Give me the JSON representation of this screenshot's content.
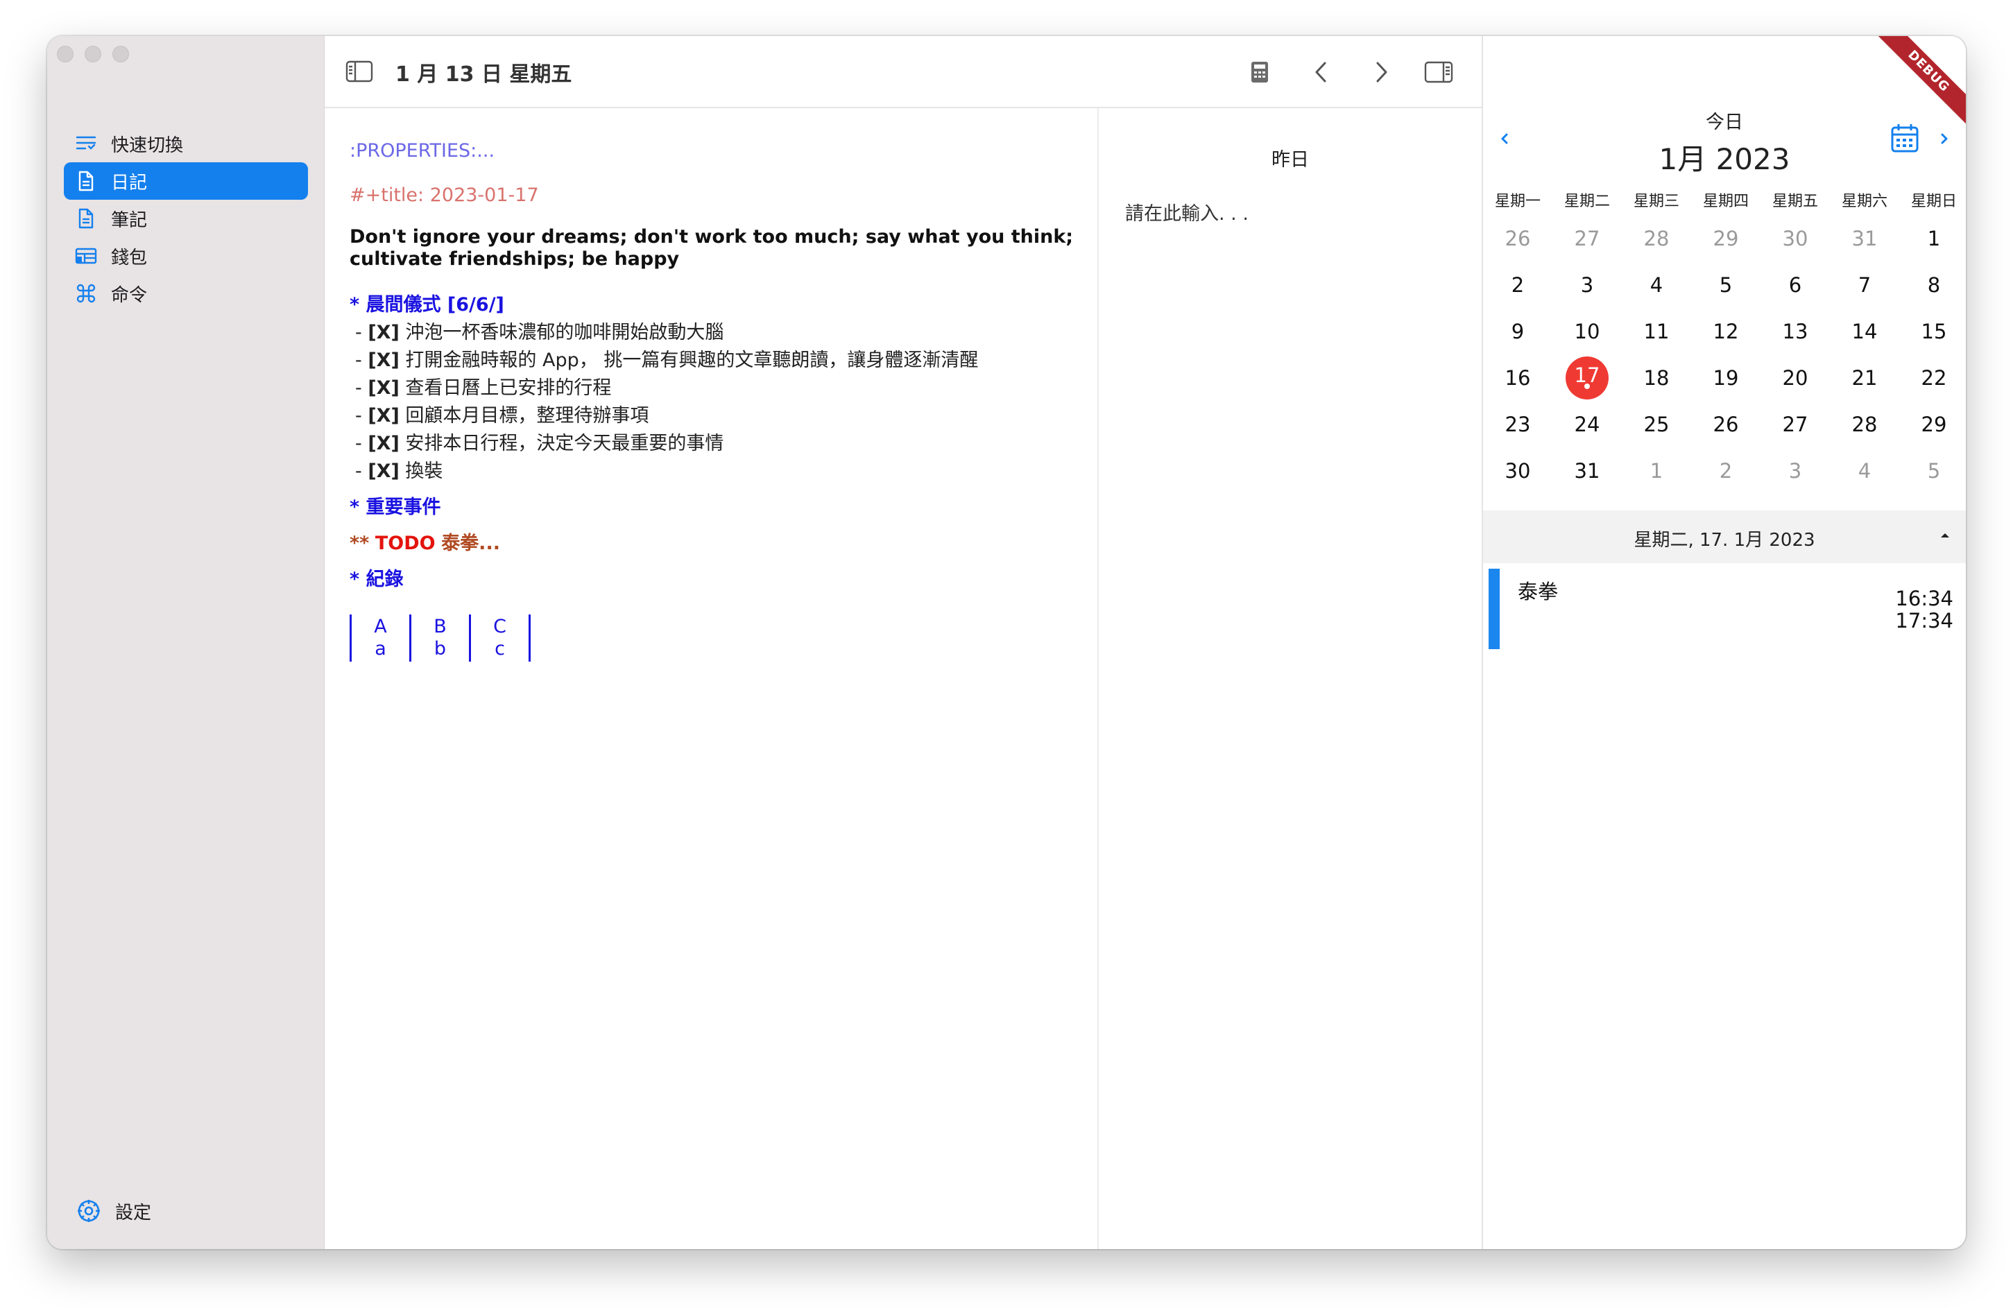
{
  "sidebar": {
    "items": [
      {
        "label": "快速切換",
        "icon": "quick-switch-icon"
      },
      {
        "label": "日記",
        "icon": "document-icon",
        "active": true
      },
      {
        "label": "筆記",
        "icon": "document-icon"
      },
      {
        "label": "錢包",
        "icon": "wallet-icon"
      },
      {
        "label": "命令",
        "icon": "command-icon"
      }
    ],
    "settings_label": "設定"
  },
  "toolbar": {
    "date": "1 月 13 日 星期五"
  },
  "document": {
    "properties": ":PROPERTIES:...",
    "title_line": "#+title: 2023-01-17",
    "quote": "Don't ignore your dreams; don't work too much; say what you think; cultivate friendships; be happy",
    "section1": "* 晨間儀式 [6/6/]",
    "checks": [
      {
        "mark": "[X]",
        "text": "沖泡一杯香味濃郁的咖啡開始啟動大腦"
      },
      {
        "mark": "[X]",
        "text": "打開金融時報的 App， 挑一篇有興趣的文章聽朗讀，讓身體逐漸清醒"
      },
      {
        "mark": "[X]",
        "text": "查看日曆上已安排的行程"
      },
      {
        "mark": "[X]",
        "text": "回顧本月目標，整理待辦事項"
      },
      {
        "mark": "[X]",
        "text": "安排本日行程，決定今天最重要的事情"
      },
      {
        "mark": "[X]",
        "text": "換裝"
      }
    ],
    "section2": "* 重要事件",
    "todo_stars": "**",
    "todo_keyword": "TODO",
    "todo_title": "泰拳...",
    "section3": "* 紀錄",
    "table": {
      "headers": [
        "A",
        "B",
        "C"
      ],
      "rows": [
        [
          "a",
          "b",
          "c"
        ]
      ]
    }
  },
  "yesterday": {
    "title": "昨日",
    "placeholder": "請在此輸入. . ."
  },
  "calendar": {
    "today_label": "今日",
    "month_label": "1月 2023",
    "weekdays": [
      "星期一",
      "星期二",
      "星期三",
      "星期四",
      "星期五",
      "星期六",
      "星期日"
    ],
    "weeks": [
      [
        "26",
        "27",
        "28",
        "29",
        "30",
        "31",
        "1"
      ],
      [
        "2",
        "3",
        "4",
        "5",
        "6",
        "7",
        "8"
      ],
      [
        "9",
        "10",
        "11",
        "12",
        "13",
        "14",
        "15"
      ],
      [
        "16",
        "17",
        "18",
        "19",
        "20",
        "21",
        "22"
      ],
      [
        "23",
        "24",
        "25",
        "26",
        "27",
        "28",
        "29"
      ],
      [
        "30",
        "31",
        "1",
        "2",
        "3",
        "4",
        "5"
      ]
    ],
    "selected_date": "星期二, 17. 1月 2023",
    "debug_banner": "DEBUG",
    "accent": "#1480ee",
    "selected_color": "#ef3a33"
  },
  "event": {
    "title": "泰拳",
    "start": "16:34",
    "end": "17:34",
    "color": "#1a86ee"
  }
}
